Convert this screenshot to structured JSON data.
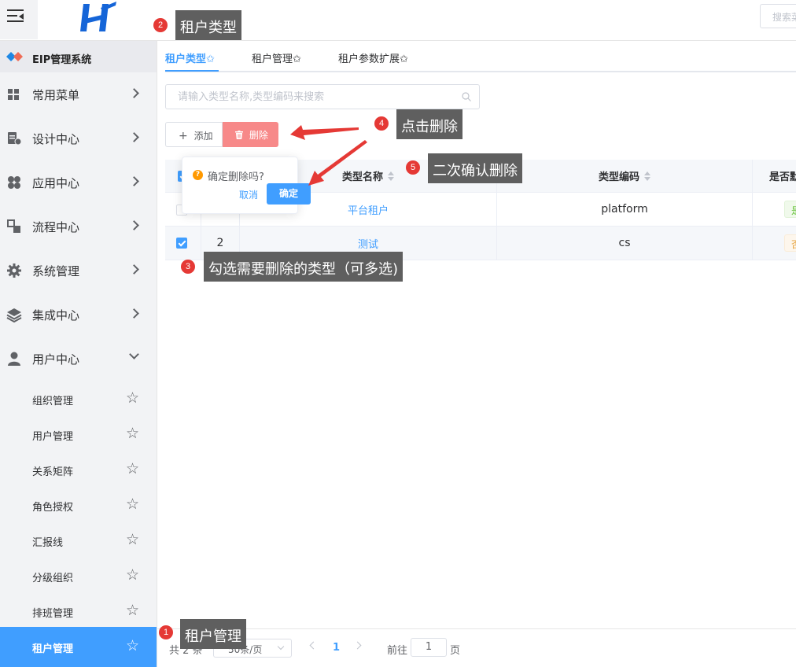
{
  "brand": {
    "name": "EIP管理系统"
  },
  "top_search": {
    "placeholder": "搜索菜"
  },
  "sidebar": {
    "menus": [
      {
        "label": "常用菜单"
      },
      {
        "label": "设计中心"
      },
      {
        "label": "应用中心"
      },
      {
        "label": "流程中心"
      },
      {
        "label": "系统管理"
      },
      {
        "label": "集成中心"
      },
      {
        "label": "用户中心"
      }
    ],
    "sub_items": [
      {
        "label": "组织管理"
      },
      {
        "label": "用户管理"
      },
      {
        "label": "关系矩阵"
      },
      {
        "label": "角色授权"
      },
      {
        "label": "汇报线"
      },
      {
        "label": "分级组织"
      },
      {
        "label": "排班管理"
      },
      {
        "label": "租户管理"
      }
    ]
  },
  "tabs": [
    {
      "label": "租户类型✩"
    },
    {
      "label": "租户管理✩"
    },
    {
      "label": "租户参数扩展✩"
    }
  ],
  "search": {
    "placeholder": "请输入类型名称,类型编码来搜索"
  },
  "toolbar": {
    "add_label": "添加",
    "delete_label": "删除"
  },
  "table": {
    "headers": {
      "name": "类型名称",
      "code": "类型编码",
      "default": "是否默"
    },
    "rows": [
      {
        "index": "",
        "name": "平台租户",
        "code": "platform",
        "default": "是",
        "checked": false
      },
      {
        "index": "2",
        "name": "测试",
        "code": "cs",
        "default": "否",
        "checked": true
      }
    ]
  },
  "popconfirm": {
    "message": "确定删除吗?",
    "cancel_label": "取消",
    "confirm_label": "确定",
    "icon": "?"
  },
  "pagination": {
    "total_text": "共 2 条",
    "page_size": "50条/页",
    "current_page": "1",
    "goto_label": "前往",
    "goto_value": "1",
    "unit_label": "页"
  },
  "annotations": [
    {
      "num": "1",
      "text": "租户管理"
    },
    {
      "num": "2",
      "text": "租户类型"
    },
    {
      "num": "3",
      "text": "勾选需要删除的类型（可多选)"
    },
    {
      "num": "4",
      "text": "点击删除"
    },
    {
      "num": "5",
      "text": "二次确认删除"
    }
  ],
  "colors": {
    "primary": "#409eff",
    "danger_light": "#f78989",
    "annotation_red": "#e53935",
    "callout_bg": "#5f5f5f"
  }
}
